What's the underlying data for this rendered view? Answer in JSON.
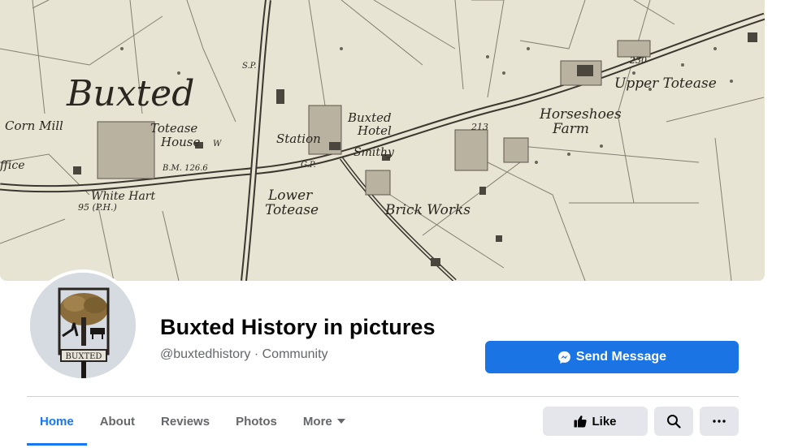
{
  "cover": {
    "map_labels": {
      "town": "Buxted",
      "corn_mill": "Corn Mill",
      "totease": "Totease",
      "house": "House",
      "station": "Station",
      "buxted_hotel_1": "Buxted",
      "buxted_hotel_2": "Hotel",
      "smithy": "Smithy",
      "horseshoes": "Horseshoes",
      "farm": "Farm",
      "upper_totease": "Upper Totease",
      "white_hart": "White Hart",
      "ph": "95   (P.H.)",
      "lower": "Lower",
      "totease2": "Totease",
      "brick_works": "Brick Works",
      "bm": "B.M. 126.6",
      "gp": "G.P.",
      "sp": "S.P.",
      "n213": "213",
      "n230": "230",
      "ffice": "ffice",
      "w": "W"
    }
  },
  "avatar": {
    "sign_text": "BUXTED"
  },
  "page": {
    "name": "Buxted History in pictures",
    "subline": "@buxtedhistory · Community"
  },
  "send_message": {
    "label": "Send Message"
  },
  "tabs": [
    {
      "label": "Home",
      "active": true
    },
    {
      "label": "About",
      "active": false
    },
    {
      "label": "Reviews",
      "active": false
    },
    {
      "label": "Photos",
      "active": false
    },
    {
      "label": "More",
      "active": false
    }
  ],
  "like": {
    "label": "Like"
  },
  "colors": {
    "primary": "#1b74e4",
    "active_tab": "#1877f2",
    "gray_button": "#e4e6eb",
    "secondary_text": "#65676b",
    "map_paper": "#e8e4d3"
  },
  "icons": {
    "send": "messenger-icon",
    "like": "thumbs-up-icon",
    "search": "search-icon",
    "more": "more-dots-icon",
    "tab_more": "caret-down-icon"
  }
}
